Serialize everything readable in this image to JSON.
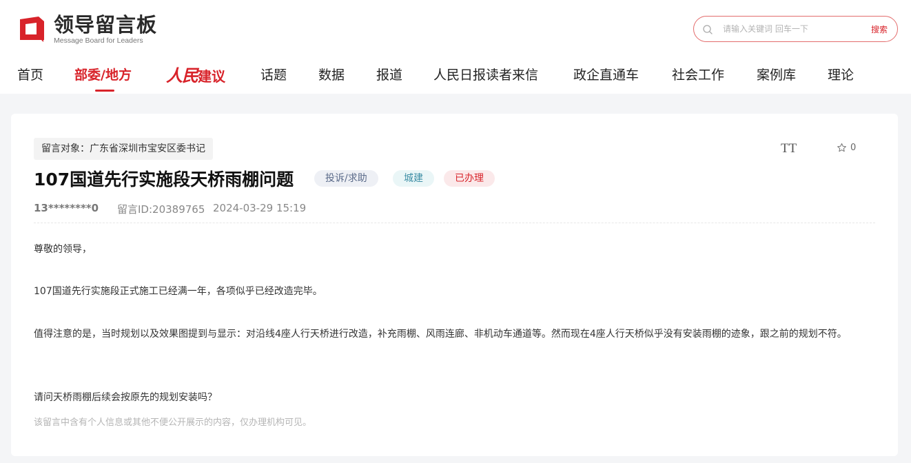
{
  "header": {
    "logo_cn": "领导留言板",
    "logo_en": "Message Board for Leaders",
    "search": {
      "placeholder": "请输入关键词 回车一下",
      "button_label": "搜索"
    }
  },
  "nav": {
    "items": [
      {
        "label": "首页"
      },
      {
        "label": "部委/地方",
        "active": true
      },
      {
        "label_script": "人民",
        "label_rest": "建议"
      },
      {
        "label": "话题"
      },
      {
        "label": "数据"
      },
      {
        "label": "报道"
      },
      {
        "label": "人民日报读者来信"
      },
      {
        "label": "政企直通车"
      },
      {
        "label": "社会工作"
      },
      {
        "label": "案例库"
      },
      {
        "label": "理论"
      }
    ]
  },
  "message": {
    "target": "留言对象：广东省深圳市宝安区委书记",
    "font_size_icon": "TT",
    "favorite_count": "0",
    "title": "107国道先行实施段天桥雨棚问题",
    "tags": {
      "type": "投诉/求助",
      "domain": "城建",
      "status": "已办理"
    },
    "author": "13********0",
    "message_id": "留言ID:20389765",
    "time": "2024-03-29 15:19",
    "paragraphs": [
      "尊敬的领导，",
      "107国道先行实施段正式施工已经满一年，各项似乎已经改造完毕。",
      "值得注意的是，当时规划以及效果图提到与显示：对沿线4座人行天桥进行改造，补充雨棚、风雨连廊、非机动车通道等。然而现在4座人行天桥似乎没有安装雨棚的迹象，跟之前的规划不符。",
      "请问天桥雨棚后续会按原先的规划安装吗？"
    ],
    "privacy_notice": "该留言中含有个人信息或其他不便公开展示的内容，仅办理机构可见。"
  },
  "colors": {
    "brand_red": "#d8232a",
    "page_bg": "#f4f5f7"
  }
}
